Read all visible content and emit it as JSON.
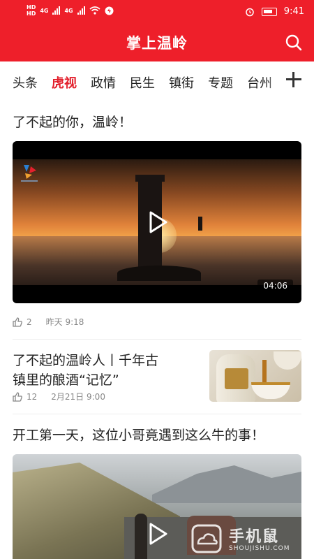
{
  "status_bar": {
    "hd1": "HD",
    "hd2": "HD",
    "net1": "4G",
    "net2": "4G",
    "time": "9:41"
  },
  "header": {
    "title": "掌上温岭",
    "search_icon": "search-icon",
    "color": "#ee1f2a"
  },
  "tabs": [
    {
      "label": "头条",
      "active": false
    },
    {
      "label": "虎视",
      "active": true
    },
    {
      "label": "政情",
      "active": false
    },
    {
      "label": "民生",
      "active": false
    },
    {
      "label": "镇街",
      "active": false
    },
    {
      "label": "专题",
      "active": false
    },
    {
      "label": "台州",
      "active": false
    }
  ],
  "feed": [
    {
      "title": "了不起的你，温岭！",
      "type": "video",
      "duration": "04:06",
      "likes": "2",
      "time": "昨天 9:18"
    },
    {
      "title_line1": "了不起的温岭人丨千年古",
      "title_line2": "镇里的酿酒“记忆”",
      "type": "article",
      "likes": "12",
      "time": "2月21日 9:00"
    },
    {
      "title": "开工第一天，这位小哥竟遇到这么牛的事！",
      "type": "video"
    }
  ],
  "watermark": {
    "cn": "手机鼠",
    "en": "SHOUJISHU.COM"
  }
}
